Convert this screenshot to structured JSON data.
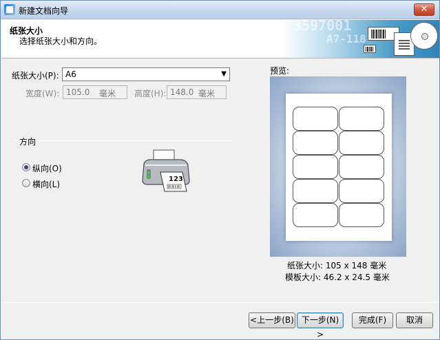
{
  "window": {
    "title": "新建文档向导",
    "close_glyph": "✕",
    "app_icon": "wizard-app-icon"
  },
  "header": {
    "title": "纸张大小",
    "subtitle": "选择纸张大小和方向。",
    "banner_numbers": [
      "3597001",
      "A7-118"
    ]
  },
  "paper": {
    "size_label": "纸张大小(P):",
    "size_value": "A6",
    "width_label": "宽度(W):",
    "width_value": "105.0",
    "width_unit": "毫米",
    "height_label": "高度(H):",
    "height_value": "148.0",
    "height_unit": "毫米"
  },
  "orientation": {
    "group_title": "方向",
    "portrait_label": "纵向(O)",
    "landscape_label": "横向(L)",
    "selected": "portrait",
    "printer_text": "123"
  },
  "preview": {
    "label": "预览:",
    "paper_size_text": "纸张大小: 105 x 148 毫米",
    "template_size_text": "模板大小: 46.2 x 24.5 毫米",
    "rows": 5,
    "cols": 2
  },
  "buttons": {
    "back": "<上一步(B)",
    "next": "下一步(N) >",
    "finish": "完成(F)",
    "cancel": "取消"
  },
  "colors": {
    "titlebar": "#c6d8ef",
    "close": "#c23e22",
    "preview_bg": "#a9bcd6",
    "banner": "#2f85b8"
  }
}
